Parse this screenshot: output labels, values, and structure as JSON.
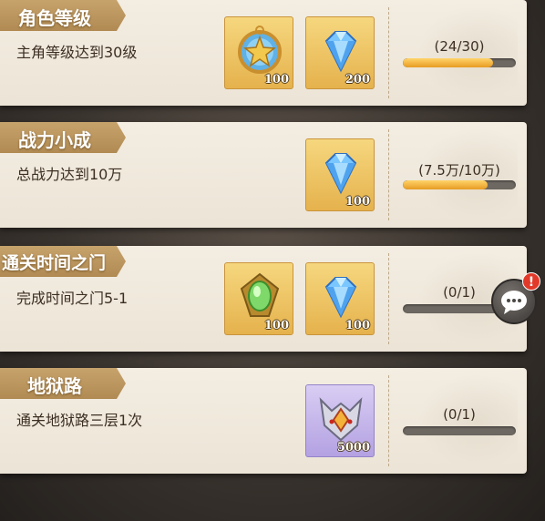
{
  "quests": [
    {
      "tag": "角色等级",
      "desc": "主角等级达到30级",
      "progress_text": "(24/30)",
      "progress": 0.8,
      "rewards": [
        {
          "icon": "star-medal-icon",
          "qty": "100",
          "bg": "gold"
        },
        {
          "icon": "diamond-icon",
          "qty": "200",
          "bg": "gold"
        }
      ]
    },
    {
      "tag": "战力小成",
      "desc": "总战力达到10万",
      "progress_text": "(7.5万/10万)",
      "progress": 0.75,
      "rewards": [
        {
          "icon": "diamond-icon",
          "qty": "100",
          "bg": "gold"
        }
      ]
    },
    {
      "tag": "通关时间之门",
      "desc": "完成时间之门5-1",
      "progress_text": "(0/1)",
      "progress": 0,
      "rewards": [
        {
          "icon": "green-crystal-icon",
          "qty": "100",
          "bg": "gold"
        },
        {
          "icon": "diamond-icon",
          "qty": "100",
          "bg": "gold"
        }
      ]
    },
    {
      "tag": "地狱路",
      "desc": "通关地狱路三层1次",
      "progress_text": "(0/1)",
      "progress": 0,
      "rewards": [
        {
          "icon": "demon-mask-icon",
          "qty": "5000",
          "bg": "purple"
        }
      ]
    }
  ],
  "chat": {
    "icon": "chat-bubble-icon",
    "badge": "!"
  },
  "colors": {
    "tag": "#b8925a",
    "bar_fill": "#f0b23a",
    "bar_track": "#6e6862",
    "card": "#efe8dc"
  }
}
